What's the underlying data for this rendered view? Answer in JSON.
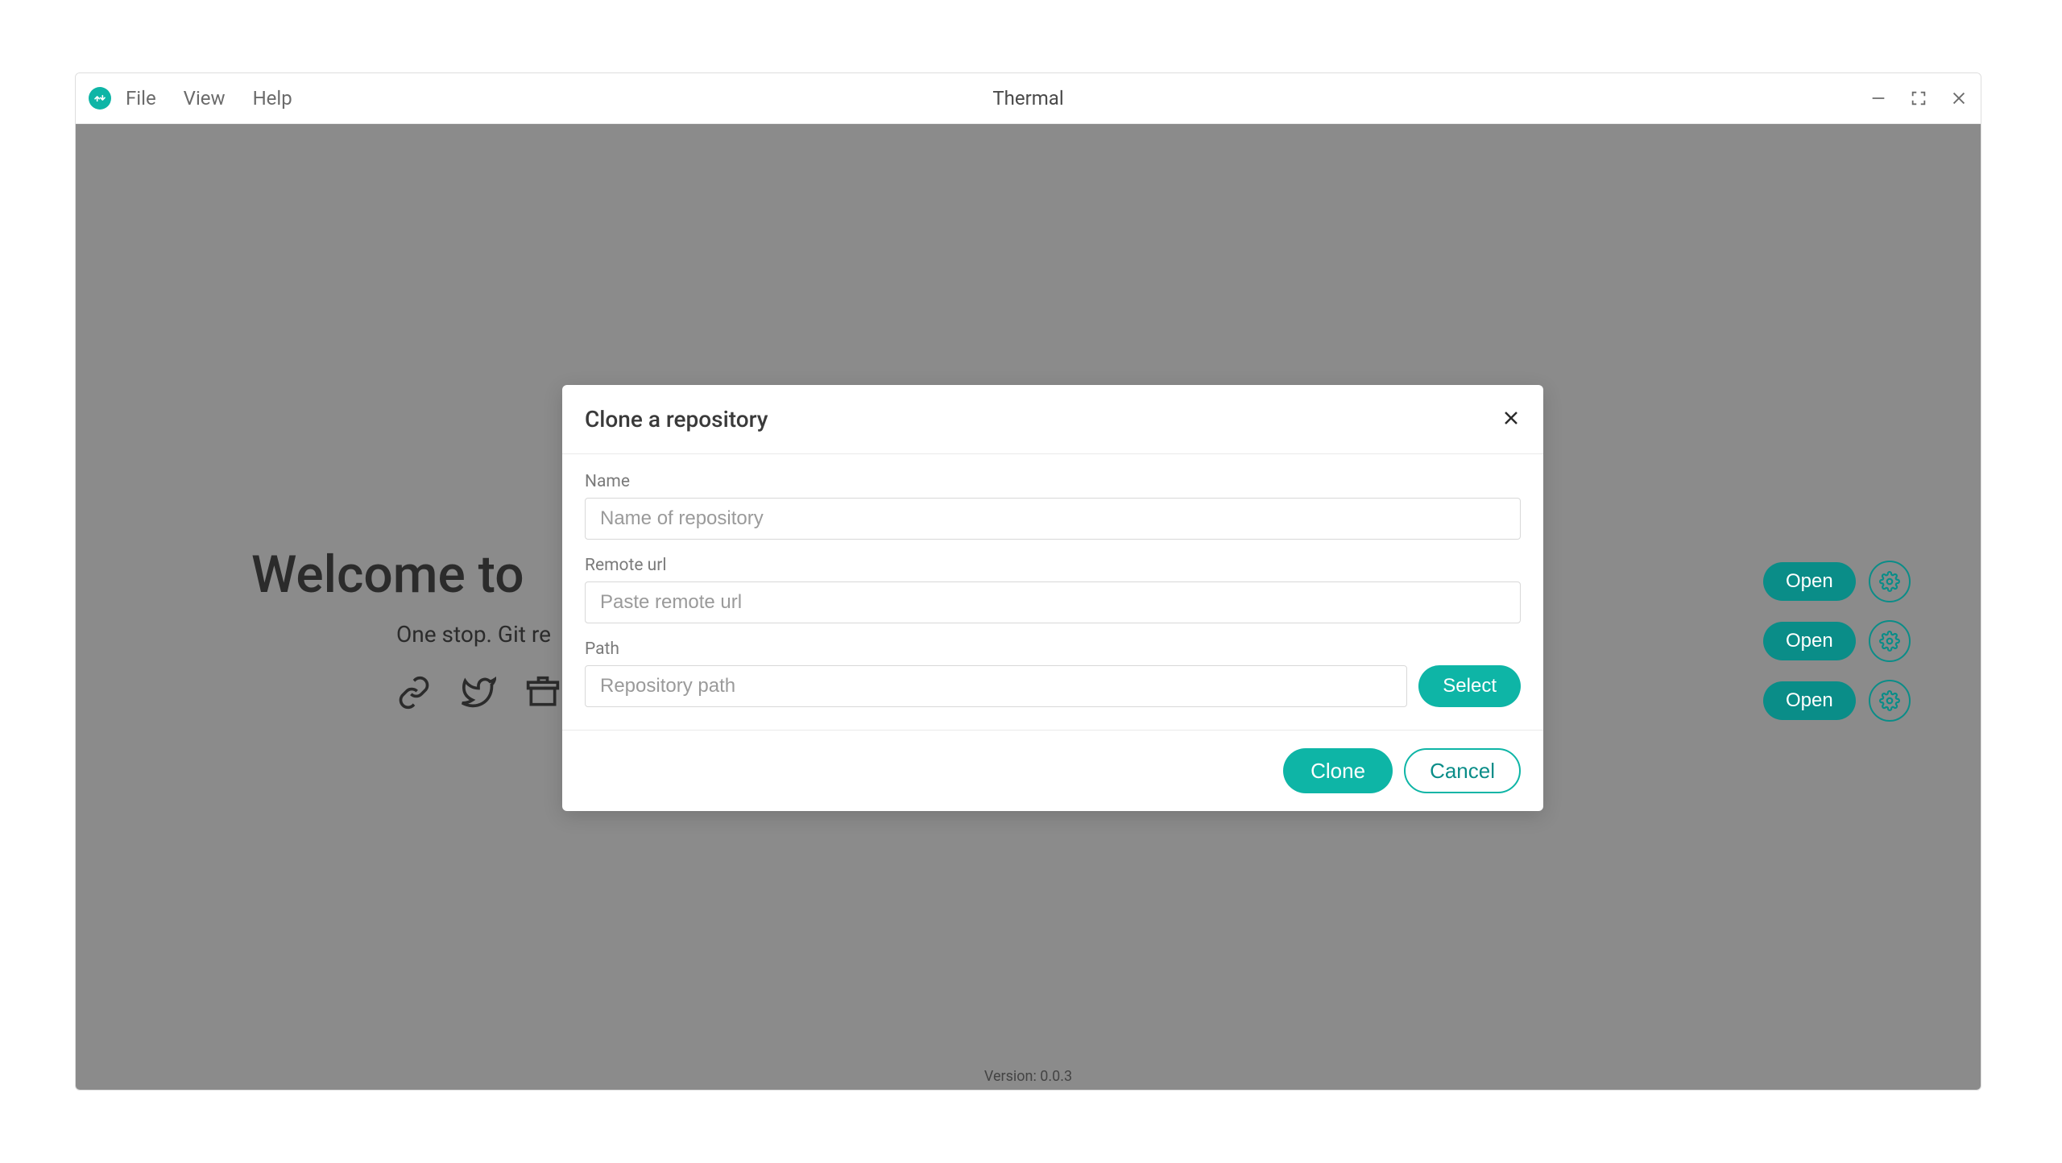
{
  "titlebar": {
    "app_name": "Thermal",
    "menus": [
      "File",
      "View",
      "Help"
    ]
  },
  "welcome": {
    "title": "Welcome to",
    "subtitle": "One stop. Git re"
  },
  "actions": {
    "open_label": "Open"
  },
  "version": "Version: 0.0.3",
  "modal": {
    "title": "Clone a repository",
    "fields": {
      "name_label": "Name",
      "name_placeholder": "Name of repository",
      "remote_label": "Remote url",
      "remote_placeholder": "Paste remote url",
      "path_label": "Path",
      "path_placeholder": "Repository path"
    },
    "select_label": "Select",
    "clone_label": "Clone",
    "cancel_label": "Cancel"
  }
}
